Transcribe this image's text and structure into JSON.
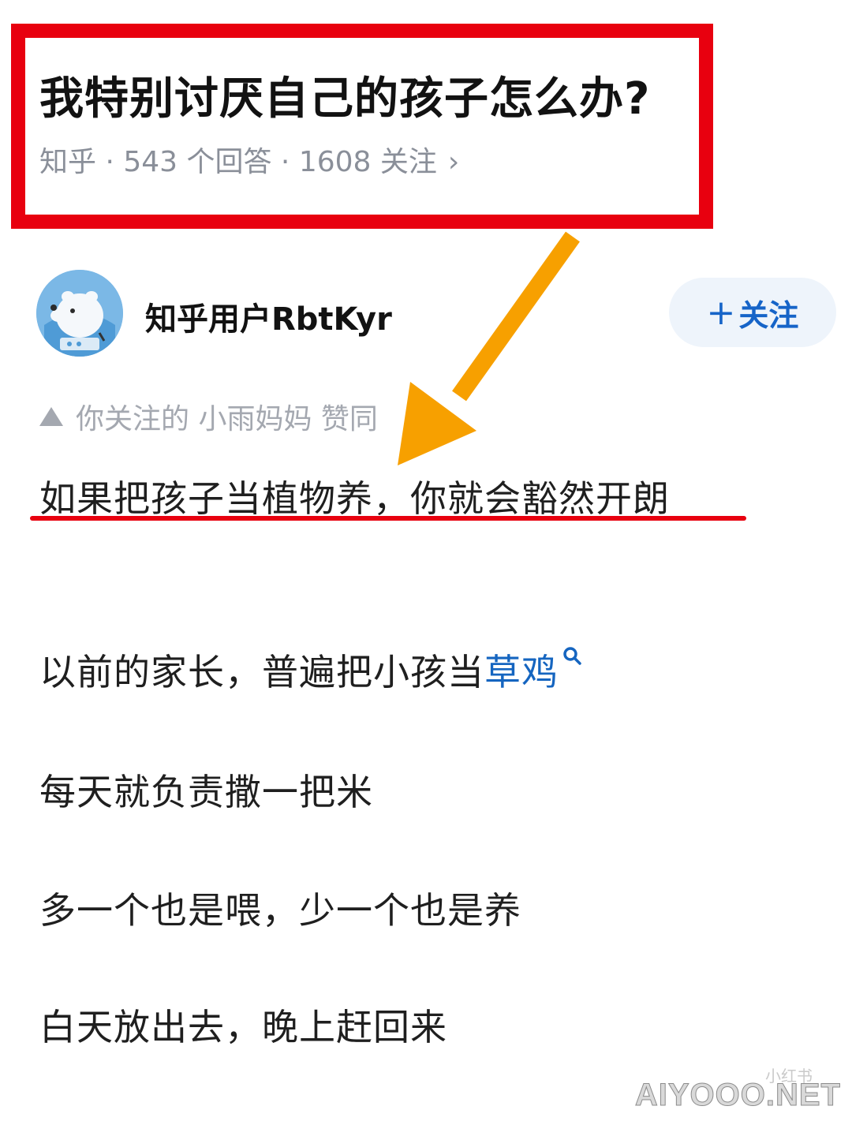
{
  "question": {
    "title": "我特别讨厌自己的孩子怎么办?",
    "meta": "知乎 · 543 个回答 · 1608 关注",
    "chevron": "›"
  },
  "author": {
    "name": "知乎用户RbtKyr",
    "avatar_icon": "polar-bear-avatar-icon",
    "follow_label": "关注",
    "follow_plus": "+"
  },
  "vote_hint": "你关注的 小雨妈妈 赞同",
  "answer": {
    "lead": "如果把孩子当植物养，你就会豁然开朗",
    "p1_text": "以前的家长，普遍把小孩当",
    "p1_link": "草鸡",
    "p2": "每天就负责撒一把米",
    "p3": "多一个也是喂，少一个也是养",
    "p4": "白天放出去，晚上赶回来"
  },
  "annotation": {
    "box_color": "#e8000f",
    "arrow_color": "#f7a000",
    "underline_color": "#e8000f"
  },
  "watermark": {
    "main": "AIYOOO.NET",
    "small": "小红书"
  }
}
